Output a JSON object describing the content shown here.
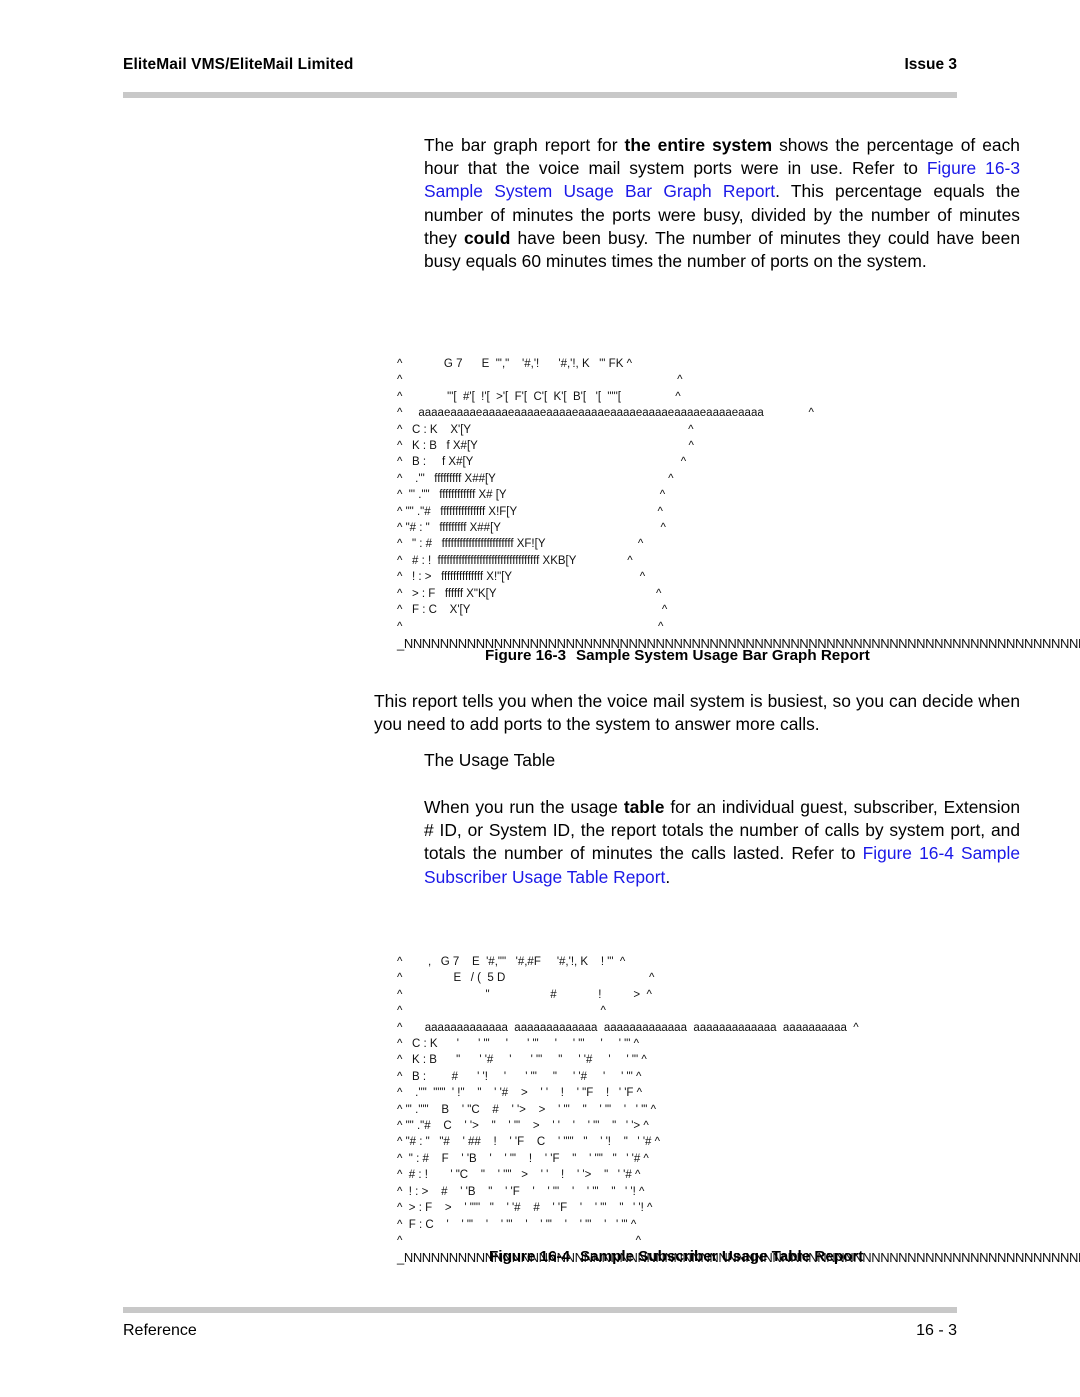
{
  "header": {
    "title": "EliteMail VMS/EliteMail Limited",
    "issue": "Issue 3"
  },
  "body": {
    "para_intro": {
      "segments": [
        {
          "text": "The bar graph report for ",
          "style": "normal"
        },
        {
          "text": "the entire system",
          "style": "bold"
        },
        {
          "text": " shows the percentage of each hour that the voice mail system ports were in use. Refer to ",
          "style": "normal"
        },
        {
          "text": "Figure 16-3 Sample System Usage Bar Graph Report",
          "style": "xref"
        },
        {
          "text": ". This percentage equals the number of minutes the ports were busy, divided by the number of minutes they ",
          "style": "normal"
        },
        {
          "text": "could",
          "style": "bold"
        },
        {
          "text": " have been busy. The number of minutes they could have been busy equals 60 minutes times the number of ports on the system.",
          "style": "normal"
        }
      ]
    },
    "para_busiest": {
      "segments": [
        {
          "text": "This report tells you when the voice mail system is busiest, so you can decide when you need to add ports to the system to answer more calls.",
          "style": "normal"
        }
      ]
    },
    "subhead_usage_table": "The Usage Table",
    "para_usage": {
      "segments": [
        {
          "text": "When you run the usage ",
          "style": "normal"
        },
        {
          "text": "table",
          "style": "bold"
        },
        {
          "text": " for an individual guest, subscriber, Extension # ID, or System ID, the report totals the number of calls by system port, and totals the number of minutes the calls lasted. Refer to ",
          "style": "normal"
        },
        {
          "text": "Figure 16-4 Sample Subscriber Usage Table Report",
          "style": "xref"
        },
        {
          "text": ".",
          "style": "normal"
        }
      ]
    }
  },
  "figure_1": {
    "caption_number": "Figure 16-3",
    "caption_text": "Sample System Usage Bar Graph Report",
    "art_lines": [
      "^             G 7      E  \"',\"    '#,'!      '#,'!, K   \"' FK ^",
      "^                                                                                      ^",
      "^              \"'[  #'[  !'[  >'[  F'[  C'[  K'[  B'[   '[  \"\"'[                 ^",
      "^     aaaaeaaaaeaaaaeaaaaeaaaaeaaaaeaaaaeaaaaeaaaaeaaaaeaaaa              ^",
      "^   C : K    X'[Y                                                                    ^",
      "^   K : B   f X#[Y                                                                  ^",
      "^   B :     f X#[Y                                                                 ^",
      "^    .'\"   fffffffff X##[Y                                                      ^",
      "^  \"' .\"\"   ffffffffffff X# [Y                                                ^",
      "^ \"\" .\"#   fffffffffffffff X!F[Y                                            ^",
      "^ \"# : \"   fffffffff X##[Y                                                  ^",
      "^   \" : #   ffffffffffffffffffffffff XF![Y                             ^",
      "^   # : !  ffffffffffffffffffffffffffffffffff XKB[Y                ^",
      "^   ! : >   ffffffffffffff X!\"[Y                                        ^",
      "^   > : F   ffffff X\"K[Y                                                  ^",
      "^   F : C    X'[Y                                                            ^",
      "^                                                                                ^"
    ],
    "rule_line": "_NNNNNNNNNNNNNNNNNNNNNNNNNNNNNNNNNNNNNNNNNNNNNNNNNNNNNNNNNNNNNNNNNNNNNNNNNNNNNNNNNNNN"
  },
  "figure_2": {
    "caption_number": "Figure 16-4",
    "caption_text": "Sample Subscriber Usage Table Report",
    "art_lines": [
      "^        ,   G 7    E  '#,\"\"   '#,#F     '#,'!, K    ! \"'  ^",
      "^                E   / (  5 D                                             ^",
      "^                          \"                   #             !          >  ^",
      "^                                                              ^",
      "^       aaaaaaaaaaaaa  aaaaaaaaaaaaa  aaaaaaaaaaaaa  aaaaaaaaaaaaa  aaaaaaaaaa  ^",
      "^   C : K      '      ' \"'     '      ' \"'     '     ' \"'     '     ' \"' ^",
      "^   K : B      \"      ' '#     '      ' \"'     \"     ' '#     '     ' \"' ^",
      "^   B :        #      ' '!     '      ' \"'     \"     ' '#     '     ' \"' ^",
      "^    .'\"'  \"\"\"  ' !\"    \"    ' '#    >    ' '    !    ' \"F    !   ' 'F ^",
      "^ \"' .'\"\"    B    ' \"C    #    ' '>    >    ' \"'    \"    ' '\"    '   ' '\" ^",
      "^ \"\" .\"#    C    ' '>    \"    ' '\"    >    ' '    '    ' \"'    \"   ' '> ^",
      "^ \"# : \"   \"#    ' ##    !    ' 'F    C    ' \"\"'   \"    ' '!    \"   ' '# ^",
      "^  \" : #    F    ' 'B    '    ' \"'    !    ' 'F    \"    ' '\"'   \"   ' '# ^",
      "^  # : !       ' \"C    \"    ' '\"'   >    ' '    !    ' '>    \"   ' '# ^",
      "^  ! : >    #    ' 'B    \"    ' 'F    '    ' \"'    '    ' \"'    \"   ' '! ^",
      "^  > : F    >    ' \"\"'   \"    ' '#    #    ' 'F    '    ' \"'    \"   ' '! ^",
      "^  F : C    '    ' \"'    '    ' \"'    '    ' \"'    '    ' \"'    '   ' \"' ^",
      "^                                                                         ^"
    ],
    "rule_line": "_NNNNNNNNNNNNNNNNNNNNNNNNNNNNNNNNNNNNNNNNNNNNNNNNNNNNNNNNNNNNNNNNNNNNNNNNNNNNNNNNNNNN"
  },
  "footer": {
    "section": "Reference",
    "page_number": "16 - 3"
  },
  "colors": {
    "cross_reference": "#1b19e8",
    "rule_gray": "#c8c8c8",
    "text": "#000000"
  }
}
